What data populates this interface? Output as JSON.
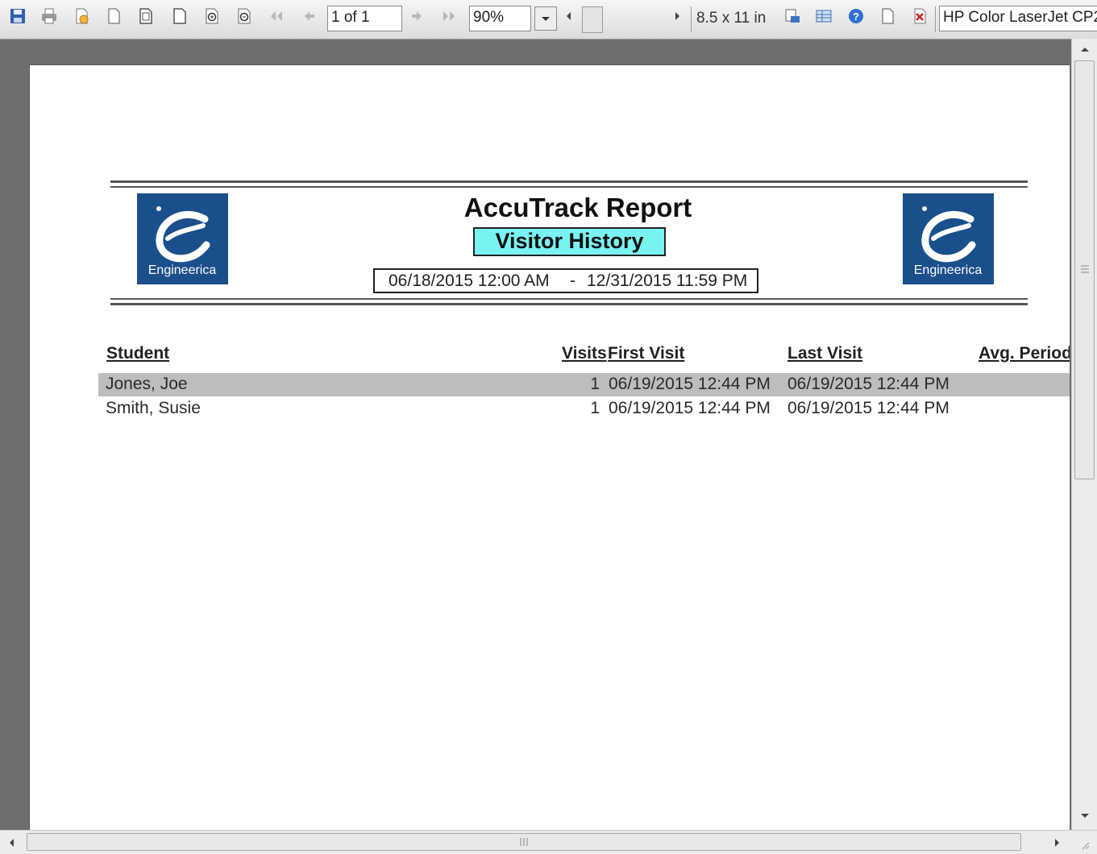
{
  "toolbar": {
    "page_indicator": "1 of 1",
    "zoom": "90%",
    "paper_size": "8.5 x 11 in",
    "printer": "HP Color LaserJet CP2",
    "icons": [
      "save-icon",
      "print-icon",
      "page-setup-icon",
      "page-icon",
      "page-width-icon",
      "full-page-icon",
      "zoom-in-icon",
      "zoom-out-icon",
      "first-page-icon",
      "previous-page-icon",
      "next-page-icon",
      "last-page-icon",
      "dropdown-arrow-icon",
      "scroll-left-icon",
      "scroll-right-icon",
      "printer-setup-icon",
      "columns-icon",
      "help-icon",
      "new-page-icon",
      "close-icon"
    ]
  },
  "report": {
    "logo_text": "Engineerica",
    "title": "AccuTrack Report",
    "subtitle": "Visitor History",
    "date_start": "06/18/2015 12:00 AM",
    "date_separator": "-",
    "date_end": "12/31/2015 11:59 PM",
    "columns": {
      "student": "Student",
      "visits": "Visits",
      "first_visit": "First Visit",
      "last_visit": "Last Visit",
      "avg_period": "Avg. Period"
    },
    "rows": [
      {
        "student": "Jones, Joe",
        "visits": "1",
        "first_visit": "06/19/2015 12:44 PM",
        "last_visit": "06/19/2015 12:44 PM"
      },
      {
        "student": "Smith, Susie",
        "visits": "1",
        "first_visit": "06/19/2015 12:44 PM",
        "last_visit": "06/19/2015 12:44 PM"
      }
    ]
  },
  "colors": {
    "subtitle_bg": "#79f2f2",
    "logo_bg": "#1a4f8c",
    "row_highlight": "#bdbdbd",
    "viewer_bg": "#6e6e6e"
  }
}
